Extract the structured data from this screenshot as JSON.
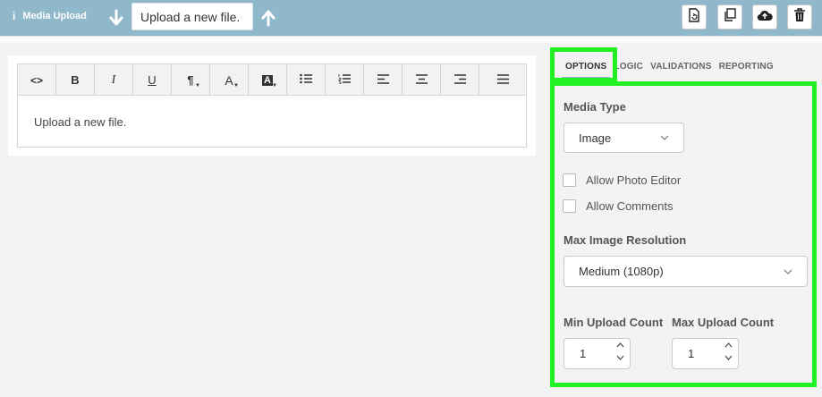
{
  "topbar": {
    "info_glyph": "i",
    "title": "Media Upload",
    "question_text": "Upload a new file.",
    "buttons": [
      "file-refresh-icon",
      "copy-icon",
      "cloud-upload-icon",
      "trash-icon"
    ]
  },
  "editor": {
    "toolbar": {
      "code": "<>",
      "bold": "B",
      "italic": "I",
      "underline": "U",
      "paragraph": "¶",
      "font_color": "A",
      "bg_color": "A"
    },
    "content": "Upload a new file."
  },
  "tabs": [
    "OPTIONS",
    "LOGIC",
    "VALIDATIONS",
    "REPORTING"
  ],
  "options": {
    "media_type": {
      "label": "Media Type",
      "value": "Image"
    },
    "allow_photo_editor": {
      "label": "Allow Photo Editor",
      "checked": false
    },
    "allow_comments": {
      "label": "Allow Comments",
      "checked": false
    },
    "max_resolution": {
      "label": "Max Image Resolution",
      "value": "Medium (1080p)"
    },
    "min_upload": {
      "label": "Min Upload Count",
      "value": "1"
    },
    "max_upload": {
      "label": "Max Upload Count",
      "value": "1"
    }
  },
  "colors": {
    "topbar": "#8fb8cb",
    "highlight": "#22f022"
  }
}
